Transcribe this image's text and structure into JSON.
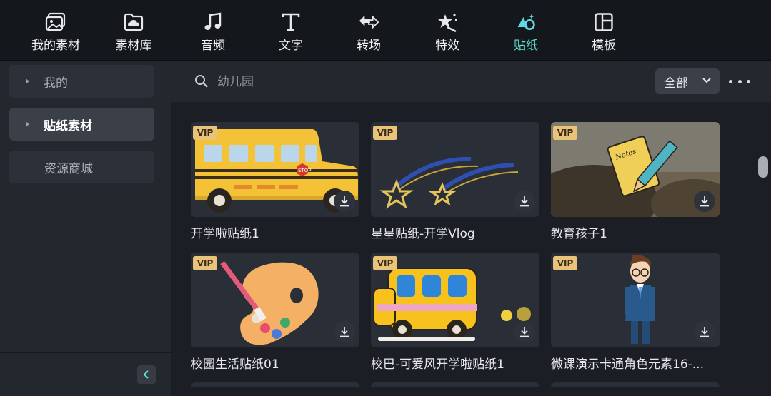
{
  "toolbar": {
    "tabs": [
      {
        "label": "我的素材",
        "icon": "my-media-icon"
      },
      {
        "label": "素材库",
        "icon": "library-cloud-icon"
      },
      {
        "label": "音频",
        "icon": "music-note-icon"
      },
      {
        "label": "文字",
        "icon": "text-t-icon"
      },
      {
        "label": "转场",
        "icon": "transition-arrows-icon"
      },
      {
        "label": "特效",
        "icon": "effects-star-icon"
      },
      {
        "label": "贴纸",
        "icon": "sticker-shapes-icon"
      },
      {
        "label": "模板",
        "icon": "template-layout-icon"
      }
    ],
    "active_index": 6
  },
  "sidebar": {
    "items": [
      {
        "label": "我的"
      },
      {
        "label": "贴纸素材"
      },
      {
        "label": "资源商城"
      }
    ],
    "collapse_icon": "chevron-left-icon"
  },
  "search": {
    "value": "",
    "placeholder": "幼儿园",
    "filter_label": "全部",
    "more_icon": "more-dots-icon"
  },
  "grid": {
    "badge_label": "VIP",
    "cards": [
      {
        "title": "开学啦贴纸1"
      },
      {
        "title": "星星贴纸-开学Vlog"
      },
      {
        "title": "教育孩子1"
      },
      {
        "title": "校园生活贴纸01"
      },
      {
        "title": "校巴-可爱风开学啦贴纸1"
      },
      {
        "title": "微课演示卡通角色元素16-..."
      }
    ]
  },
  "colors": {
    "accent": "#5fe0d0",
    "background": "#1b1e24",
    "vip_badge": "#e9c37a"
  }
}
